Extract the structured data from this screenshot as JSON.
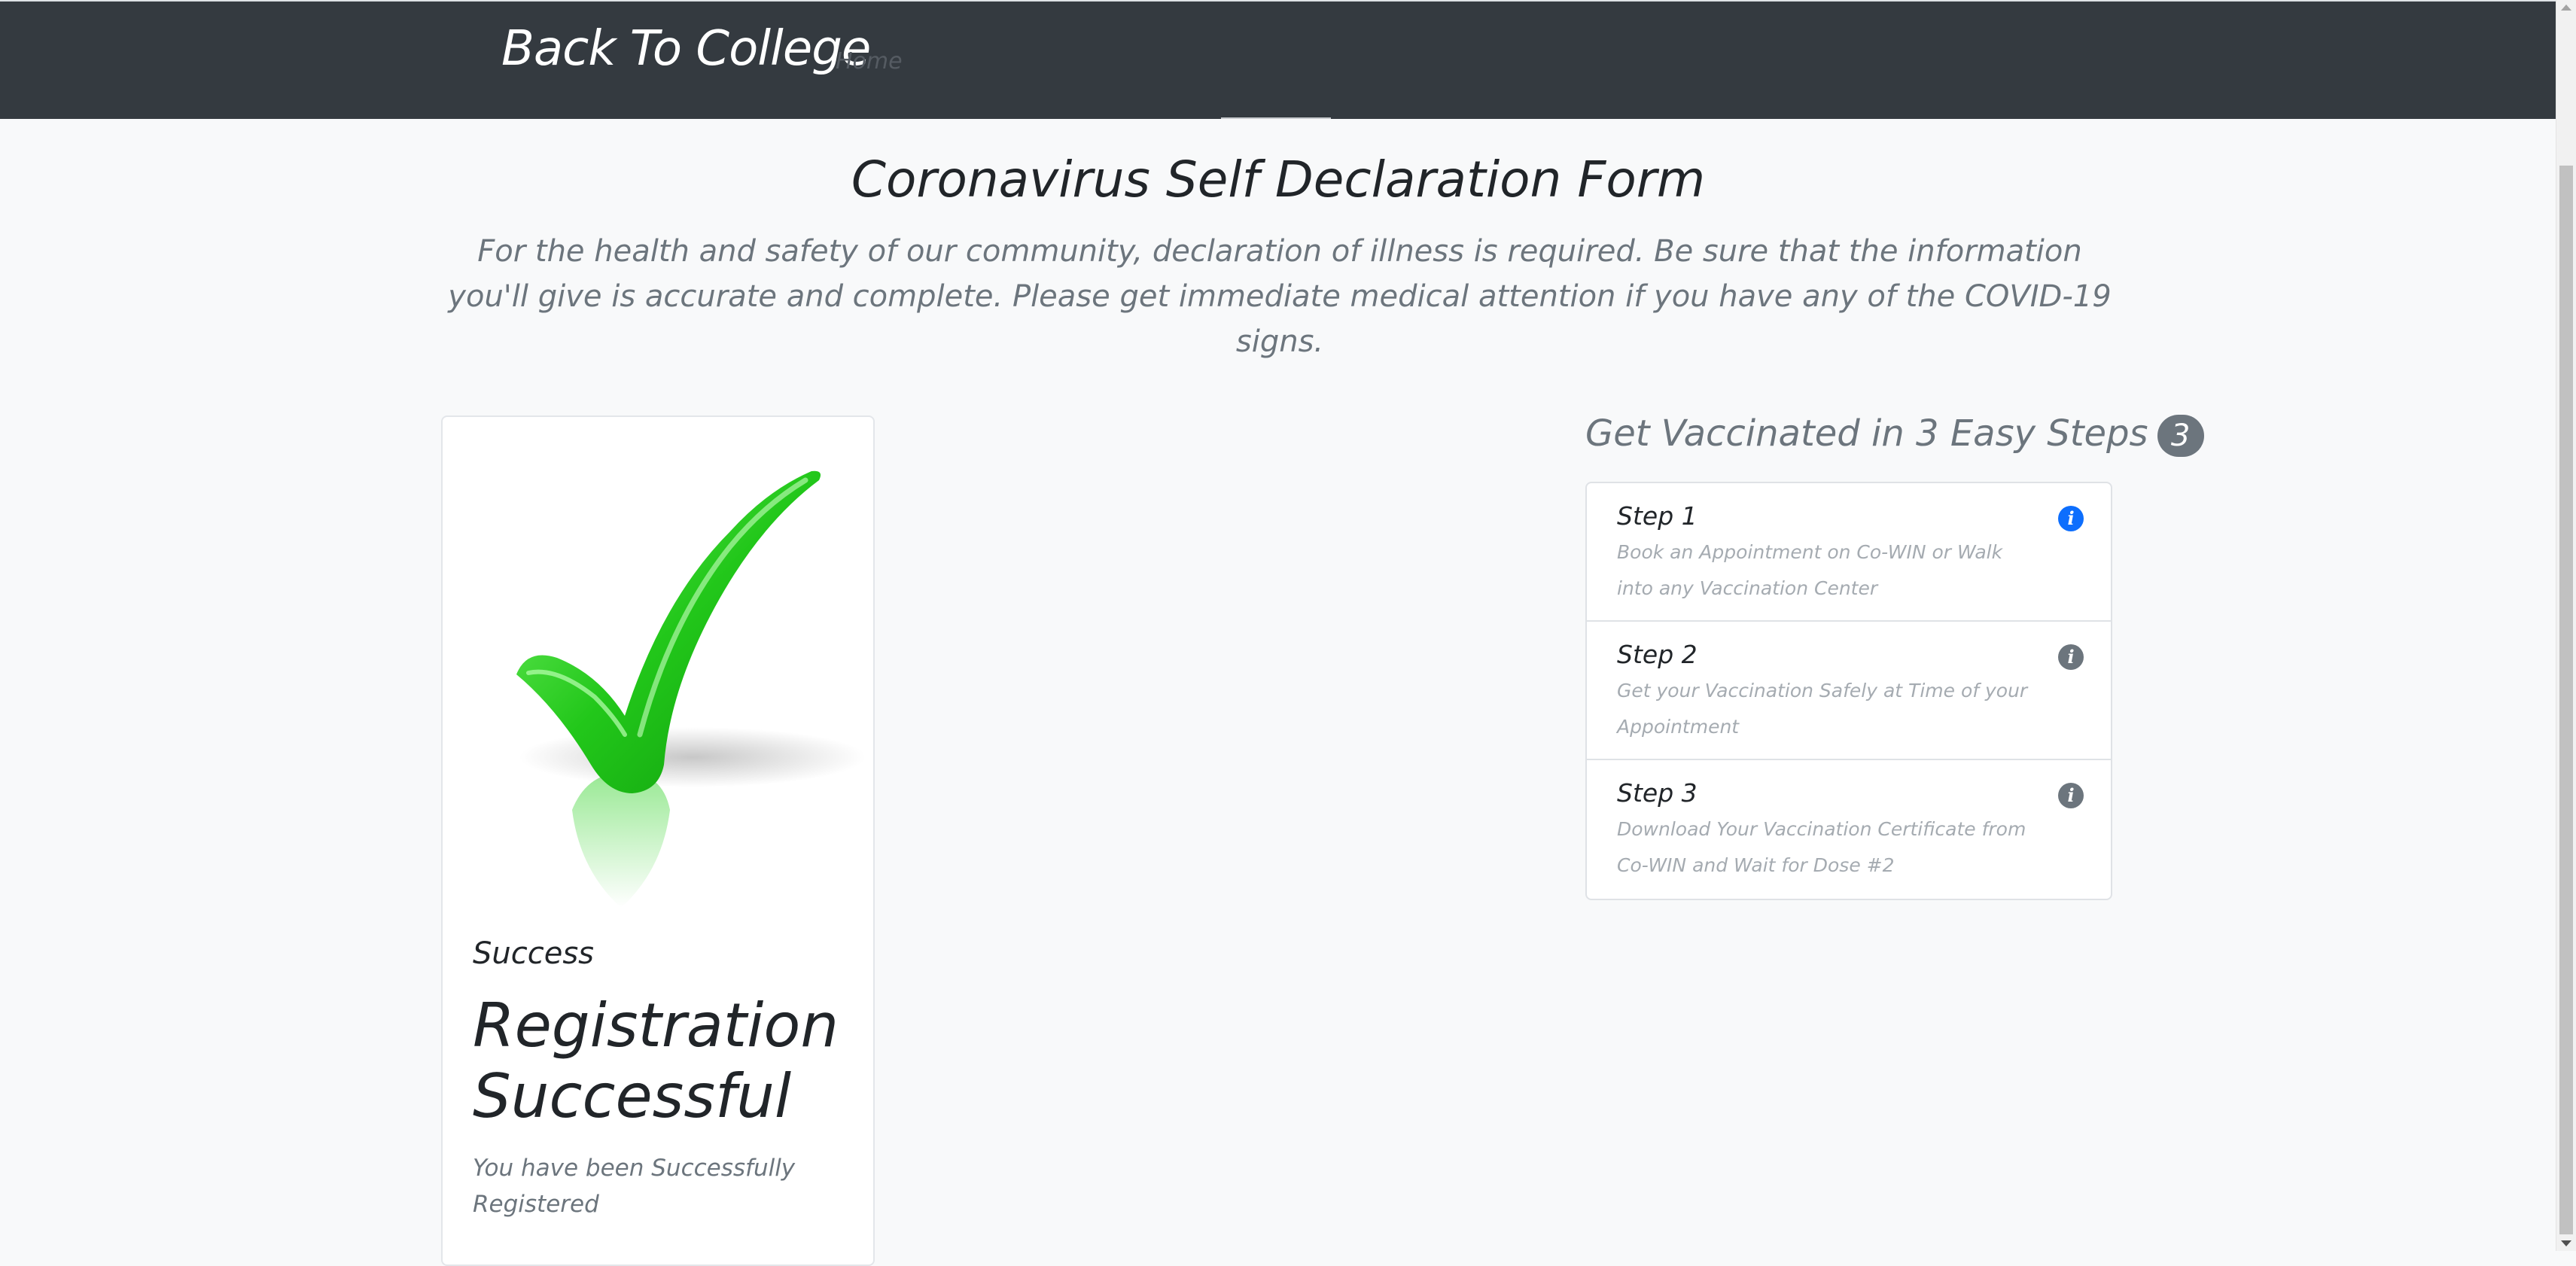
{
  "navbar": {
    "brand": "Back To College",
    "home_link": "Home"
  },
  "header": {
    "title": "Coronavirus Self Declaration Form",
    "lead": "For the health and safety of our community, declaration of illness is required. Be sure that the information you'll give is accurate and complete. Please get immediate medical attention if you have any of the COVID-19 signs."
  },
  "card": {
    "image_icon": "green-checkmark-icon",
    "subtitle": "Success",
    "title": "Registration Successful",
    "text": "You have been Successfully Registered"
  },
  "steps": {
    "heading": "Get Vaccinated in 3 Easy Steps",
    "badge": "3",
    "items": [
      {
        "title": "Step 1",
        "description": "Book an Appointment on Co-WIN or Walk into any Vaccination Center",
        "icon": "info-icon",
        "icon_color": "#0d6efd"
      },
      {
        "title": "Step 2",
        "description": "Get your Vaccination Safely at Time of your Appointment",
        "icon": "info-icon",
        "icon_color": "#6c757d"
      },
      {
        "title": "Step 3",
        "description": "Download Your Vaccination Certificate from Co-WIN and Wait for Dose #2",
        "icon": "info-icon",
        "icon_color": "#6c757d"
      }
    ]
  },
  "colors": {
    "navbar_bg": "#343a40",
    "page_bg": "#f8f9fa",
    "muted_text": "#6c757d",
    "check_green": "#22c71a"
  }
}
